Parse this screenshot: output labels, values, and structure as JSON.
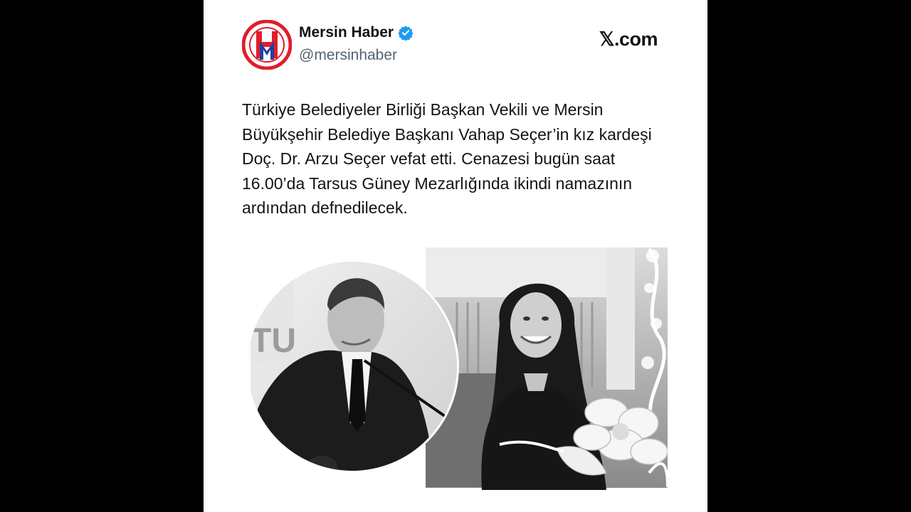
{
  "account": {
    "display_name": "Mersin Haber",
    "handle": "@mersinhaber",
    "logo_letters": "HM",
    "verified": true
  },
  "source_brand": "𝕏.com",
  "tweet": {
    "text": "Türkiye Belediyeler Birliği Başkan Vekili ve Mersin Büyükşehir Belediye Başkanı Vahap Seçer’in kız kardeşi Doç. Dr. Arzu Seçer vefat etti. Cenazesi bugün saat 16.00’da Tarsus Güney Mezarlığında ikindi namazının ardından defnedilecek."
  },
  "media": {
    "description_icons": [
      "man-portrait",
      "woman-portrait",
      "flower-frame"
    ]
  },
  "colors": {
    "logo_red": "#e11d2a",
    "logo_blue": "#1f3fa6",
    "verified_blue": "#1d9bf0",
    "text": "#0f1419",
    "muted": "#536471"
  }
}
